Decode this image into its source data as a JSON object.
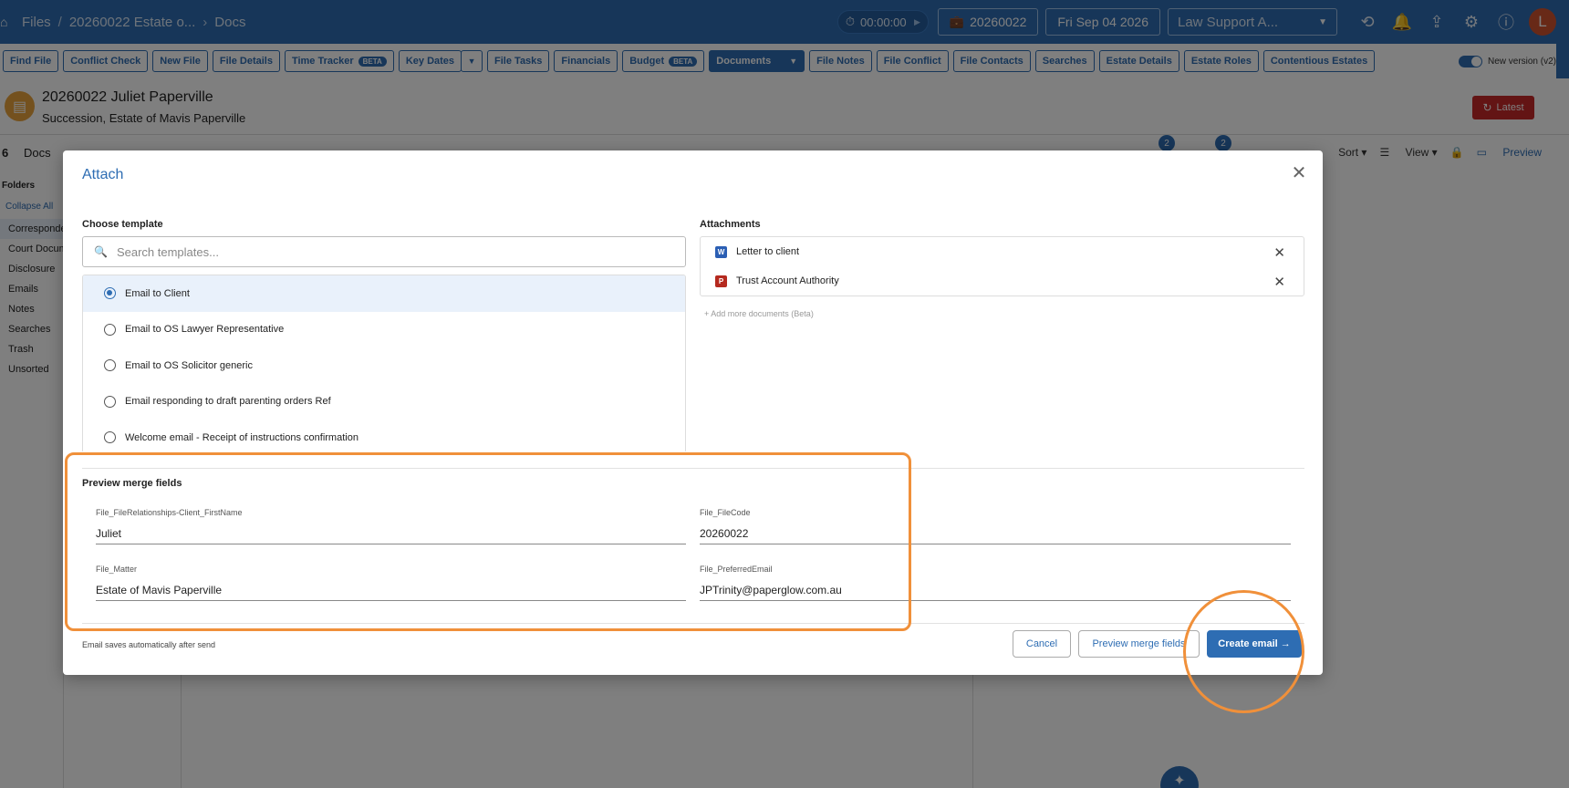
{
  "header": {
    "breadcrumb": {
      "files": "Files",
      "file": "20260022 Estate o...",
      "section": "Docs"
    },
    "timer": "00:00:00",
    "file_code": "20260022",
    "date": "Fri Sep 04 2026",
    "workspace": "Law Support A...",
    "avatar_initial": "L"
  },
  "tabs": [
    "Find File",
    "Conflict Check",
    "New File",
    "File Details",
    "Time Tracker",
    "Key Dates",
    "File Tasks",
    "Financials",
    "Budget",
    "Documents",
    "File Notes",
    "File Conflict",
    "File Contacts",
    "Searches",
    "Estate Details",
    "Estate Roles",
    "Contentious Estates"
  ],
  "beta_badge": "BETA",
  "new_version_label": "New version (v2)",
  "file": {
    "title": "20260022 Juliet Paperville",
    "subtitle": "Succession, Estate of Mavis Paperville",
    "latest_label": "Latest"
  },
  "docs": {
    "count": "6",
    "label": "Docs",
    "sort_label": "Sort",
    "view_label": "View",
    "preview_label": "Preview",
    "badge_a": "2",
    "badge_b": "2"
  },
  "sidebar": {
    "title": "Folders",
    "collapse": "Collapse All",
    "items": [
      "Correspondence",
      "Court Documents",
      "Disclosure",
      "Emails",
      "Notes",
      "Searches",
      "Trash",
      "Unsorted"
    ]
  },
  "modal": {
    "title": "Attach",
    "choose_template_label": "Choose template",
    "search_placeholder": "Search templates...",
    "templates": [
      "Email to Client",
      "Email to OS Lawyer Representative",
      "Email to OS Solicitor generic",
      "Email responding to draft parenting orders Ref",
      "Welcome email - Receipt of instructions confirmation"
    ],
    "attachments_label": "Attachments",
    "attachments": [
      {
        "name": "Letter to client",
        "icon": "word-doc-icon",
        "icon_glyph": "W"
      },
      {
        "name": "Trust Account Authority",
        "icon": "pdf-icon",
        "icon_glyph": "P"
      }
    ],
    "add_more": "+ Add more documents (Beta)",
    "merge_fields_label": "Preview merge fields",
    "merge_fields": {
      "first_name_label": "File_FileRelationships-Client_FirstName",
      "first_name_value": "Juliet",
      "file_code_label": "File_FileCode",
      "file_code_value": "20260022",
      "matter_label": "File_Matter",
      "matter_value": "Estate of Mavis Paperville",
      "email_label": "File_PreferredEmail",
      "email_value": "JPTrinity@paperglow.com.au"
    },
    "footer_note": "Email saves automatically after send",
    "cancel": "Cancel",
    "preview_merge": "Preview merge fields",
    "create_email": "Create email →"
  },
  "colors": {
    "brand_blue": "#2e6db3",
    "annotation_orange": "#f0903a",
    "latest_red": "#c62828"
  }
}
